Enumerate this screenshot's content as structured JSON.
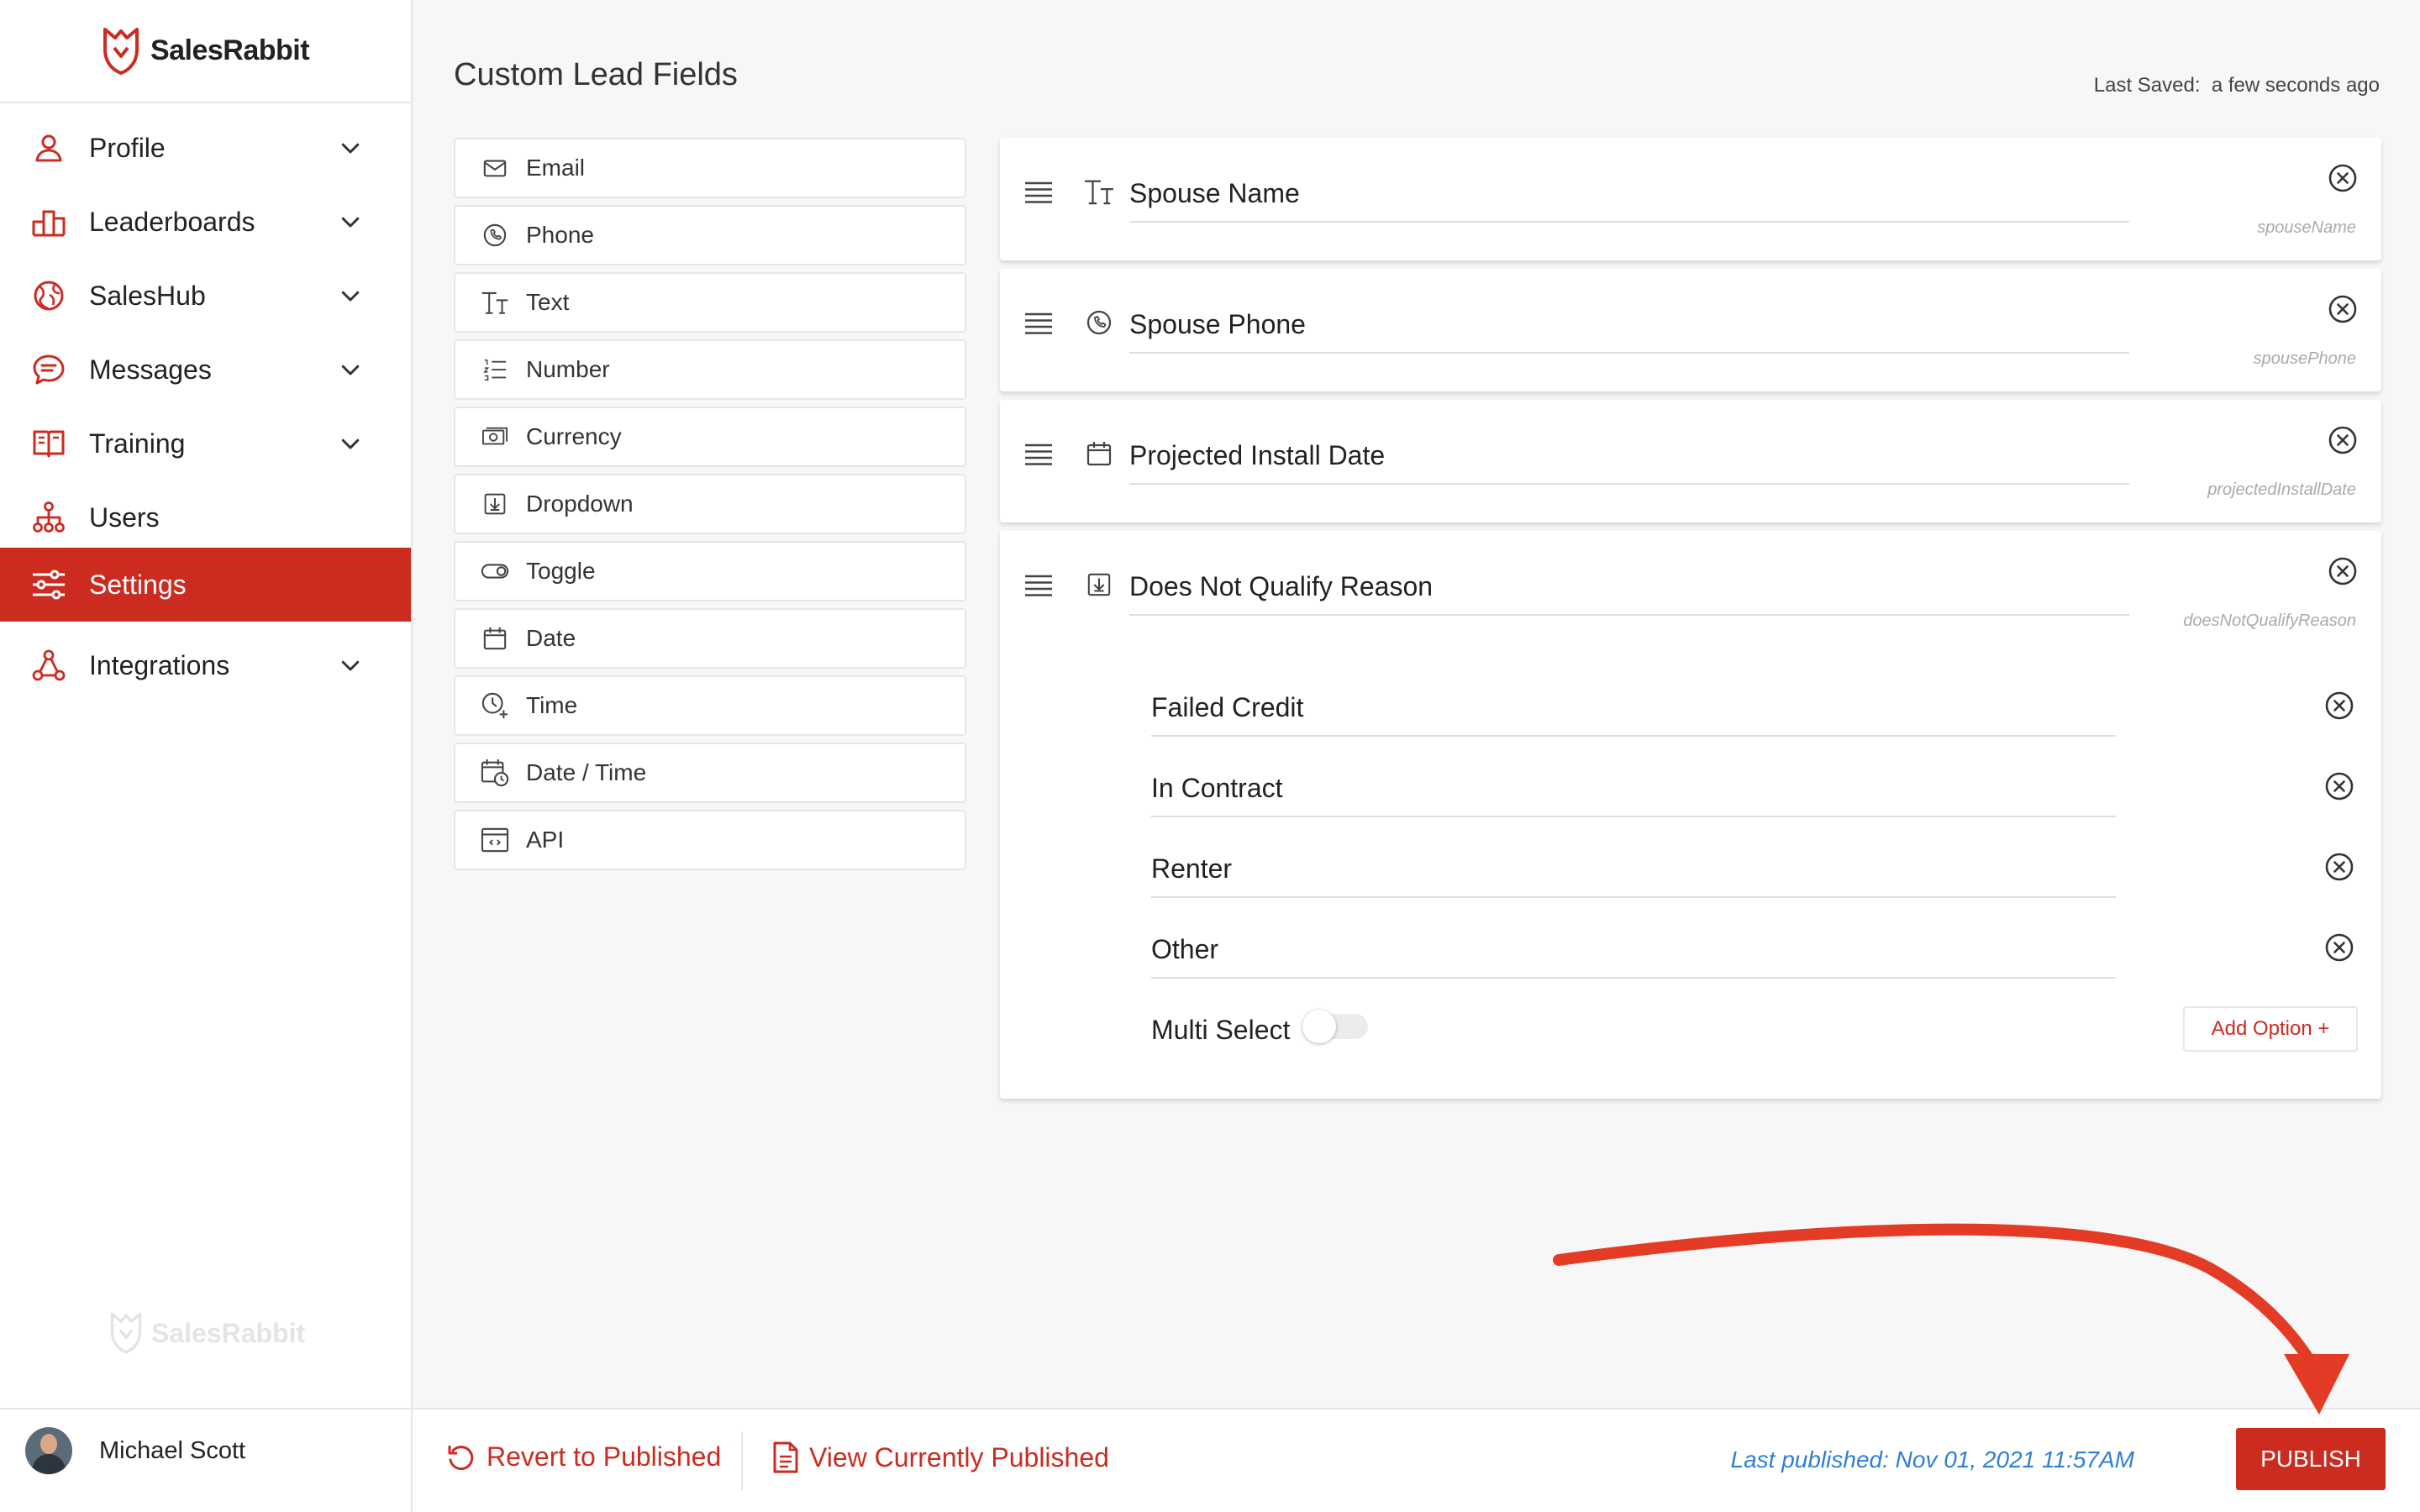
{
  "app": {
    "name": "SalesRabbit",
    "brand_color": "#cc2b20",
    "link_color": "#2f7fd6"
  },
  "sidebar": {
    "items": [
      {
        "label": "Profile",
        "icon": "person-icon",
        "has_chevron": true
      },
      {
        "label": "Leaderboards",
        "icon": "podium-icon",
        "has_chevron": true
      },
      {
        "label": "SalesHub",
        "icon": "globe-icon",
        "has_chevron": true
      },
      {
        "label": "Messages",
        "icon": "chat-icon",
        "has_chevron": true
      },
      {
        "label": "Training",
        "icon": "book-icon",
        "has_chevron": true
      },
      {
        "label": "Users",
        "icon": "org-chart-icon",
        "has_chevron": false
      },
      {
        "label": "Settings",
        "icon": "sliders-icon",
        "has_chevron": false,
        "active": true
      },
      {
        "label": "Integrations",
        "icon": "network-icon",
        "has_chevron": true
      }
    ],
    "watermark": "SalesRabbit",
    "user": {
      "name": "Michael Scott"
    }
  },
  "page": {
    "title": "Custom Lead Fields",
    "last_saved_label": "Last Saved:",
    "last_saved_value": "a few seconds ago"
  },
  "palette": [
    {
      "label": "Email",
      "icon": "envelope-icon"
    },
    {
      "label": "Phone",
      "icon": "phone-icon"
    },
    {
      "label": "Text",
      "icon": "text-icon"
    },
    {
      "label": "Number",
      "icon": "numbered-list-icon"
    },
    {
      "label": "Currency",
      "icon": "money-icon"
    },
    {
      "label": "Dropdown",
      "icon": "dropdown-icon"
    },
    {
      "label": "Toggle",
      "icon": "toggle-icon"
    },
    {
      "label": "Date",
      "icon": "calendar-icon"
    },
    {
      "label": "Time",
      "icon": "clock-plus-icon"
    },
    {
      "label": "Date / Time",
      "icon": "calendar-clock-icon"
    },
    {
      "label": "API",
      "icon": "api-window-icon"
    }
  ],
  "fields": [
    {
      "name": "Spouse Name",
      "key": "spouseName",
      "icon": "text-icon"
    },
    {
      "name": "Spouse Phone",
      "key": "spousePhone",
      "icon": "phone-icon"
    },
    {
      "name": "Projected Install Date",
      "key": "projectedInstallDate",
      "icon": "calendar-icon"
    },
    {
      "name": "Does Not Qualify Reason",
      "key": "doesNotQualifyReason",
      "icon": "dropdown-icon",
      "options": [
        "Failed Credit",
        "In Contract",
        "Renter",
        "Other"
      ],
      "multi_select_label": "Multi Select",
      "multi_select_on": false,
      "add_option_label": "Add Option +"
    }
  ],
  "footer": {
    "revert_label": "Revert to Published",
    "view_label": "View Currently Published",
    "last_published": "Last published: Nov 01, 2021 11:57AM",
    "publish_label": "PUBLISH"
  }
}
